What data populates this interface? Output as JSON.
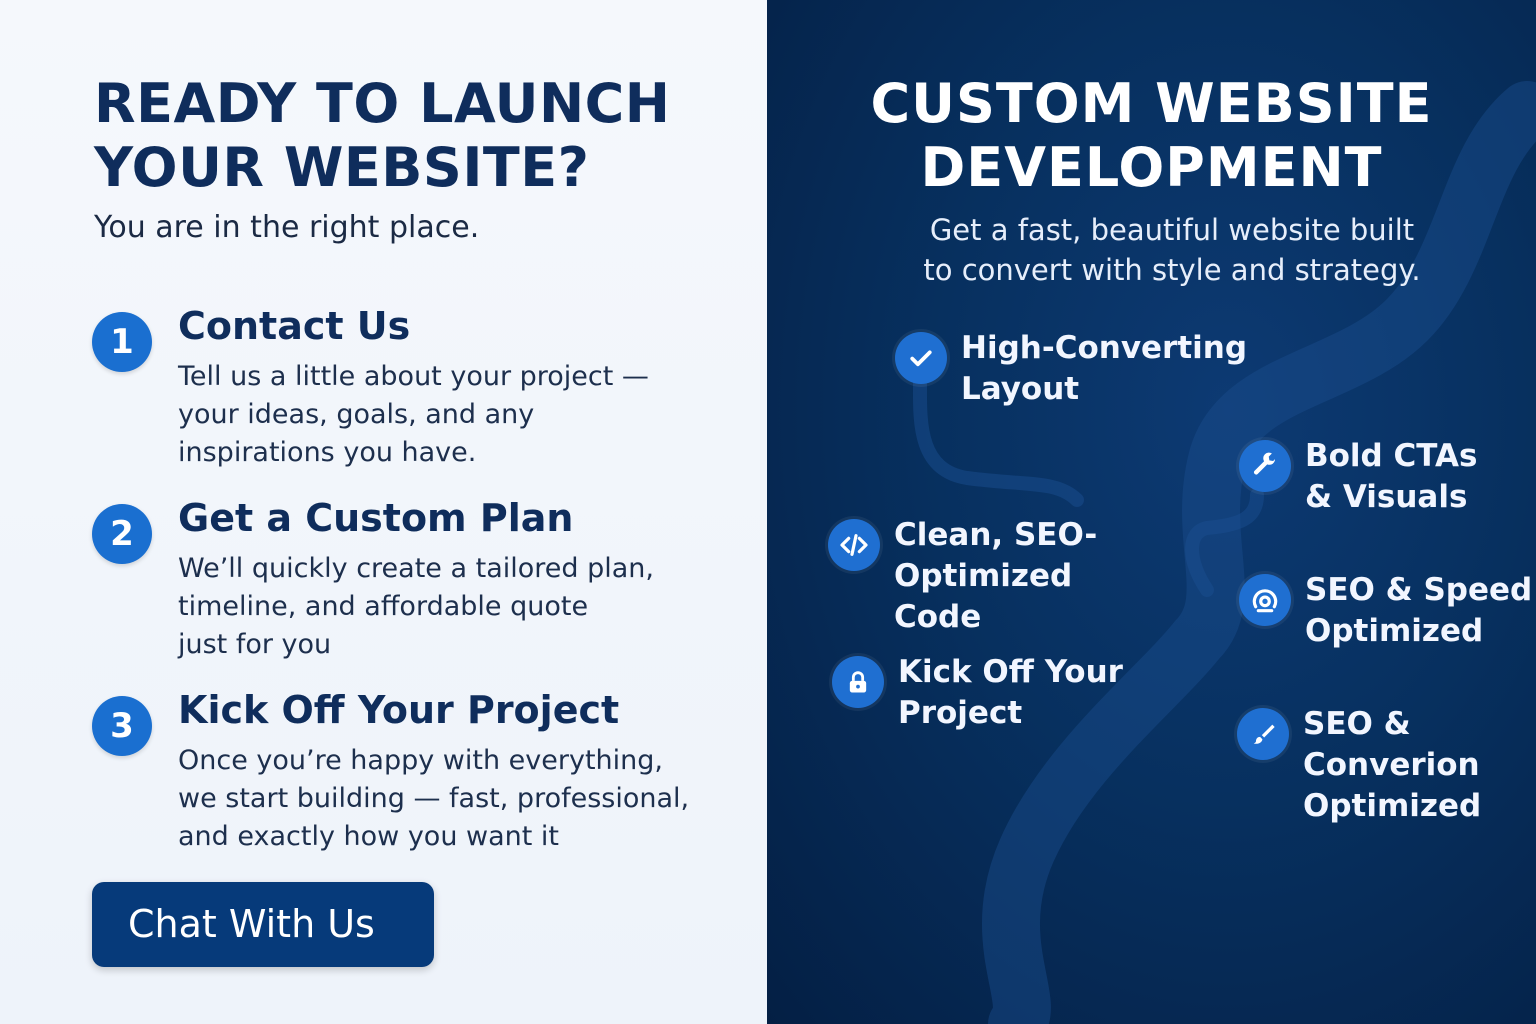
{
  "left": {
    "title_lines": [
      "READY TO LAUNCH",
      "YOUR WEBSITE?"
    ],
    "subtitle": "You are in the right place.",
    "steps": [
      {
        "number": "1",
        "title": "Contact Us",
        "desc_lines": [
          "Tell us a little about your project —",
          "your ideas, goals, and any",
          "inspirations you have."
        ]
      },
      {
        "number": "2",
        "title": "Get a Custom Plan",
        "desc_lines": [
          "We’ll quickly create a tailored plan,",
          "timeline, and affordable quote",
          "just for you"
        ]
      },
      {
        "number": "3",
        "title": "Kick Off Your Project",
        "desc_lines": [
          "Once you’re happy with everything,",
          "we start building — fast, professional,",
          "and exactly how you want it"
        ]
      }
    ],
    "cta_label": "Chat With Us"
  },
  "right": {
    "title_lines": [
      "CUSTOM WEBSITE",
      "DEVELOPMENT"
    ],
    "subtitle_lines": [
      "Get a fast, beautiful website built",
      "to convert with style and strategy."
    ],
    "features": [
      {
        "icon": "check-icon",
        "lines": [
          "High-Converting",
          "Layout"
        ]
      },
      {
        "icon": "code-icon",
        "lines": [
          "Clean, SEO-",
          "Optimized",
          "Code"
        ]
      },
      {
        "icon": "lock-icon",
        "lines": [
          "Kick Off Your",
          "Project"
        ]
      },
      {
        "icon": "wrench-icon",
        "lines": [
          "Bold CTAs",
          "& Visuals"
        ]
      },
      {
        "icon": "target-icon",
        "lines": [
          "SEO & Speed",
          "Optimized"
        ]
      },
      {
        "icon": "brush-icon",
        "lines": [
          "SEO &",
          "Converion",
          "Optimized"
        ]
      }
    ]
  },
  "colors": {
    "left_bg": "#f3f6fb",
    "right_bg": "#07305f",
    "heading_navy": "#0f2d5c",
    "accent_blue": "#1a6fd0",
    "cta_bg": "#063a7a"
  }
}
